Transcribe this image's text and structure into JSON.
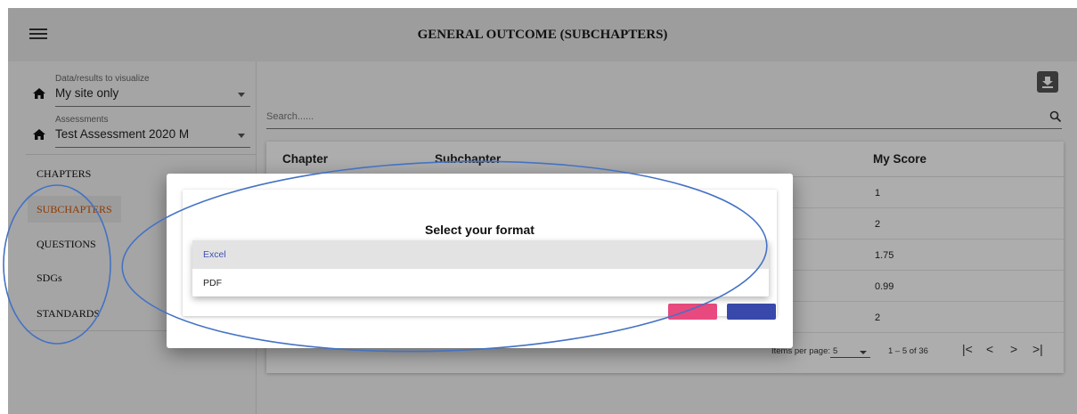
{
  "header": {
    "title": "GENERAL OUTCOME (SUBCHAPTERS)"
  },
  "sidebar": {
    "data_select": {
      "label": "Data/results to visualize",
      "value": "My site only"
    },
    "assessment_select": {
      "label": "Assessments",
      "value": "Test Assessment 2020 M"
    },
    "nav": [
      {
        "label": "CHAPTERS"
      },
      {
        "label": "SUBCHAPTERS"
      },
      {
        "label": "QUESTIONS"
      },
      {
        "label": "SDGs"
      },
      {
        "label": "STANDARDS"
      }
    ],
    "active_nav": "SUBCHAPTERS"
  },
  "search": {
    "placeholder": "Search......"
  },
  "table": {
    "columns": [
      "Chapter",
      "Subchapter",
      "My Score"
    ],
    "rows": [
      {
        "score": "1"
      },
      {
        "score": "2"
      },
      {
        "score": "1.75"
      },
      {
        "score": "0.99"
      },
      {
        "score": "2"
      }
    ]
  },
  "paginator": {
    "items_per_page_label": "Items per page:",
    "items_per_page": "5",
    "range": "1 – 5 of 36"
  },
  "dialog": {
    "title": "Select your format",
    "options": [
      "Excel",
      "PDF"
    ],
    "selected": "Excel"
  },
  "colors": {
    "active_nav": "#d35400",
    "selected_option": "#3f51b5",
    "cancel_button": "#e84a7f",
    "ok_button": "#3949ab",
    "annotation": "#4472c4"
  },
  "icons": {
    "menu": "menu-icon",
    "home": "home-icon",
    "download": "download-icon",
    "search": "search-icon",
    "first_page": "first-page-icon",
    "prev_page": "prev-page-icon",
    "next_page": "next-page-icon",
    "last_page": "last-page-icon"
  }
}
